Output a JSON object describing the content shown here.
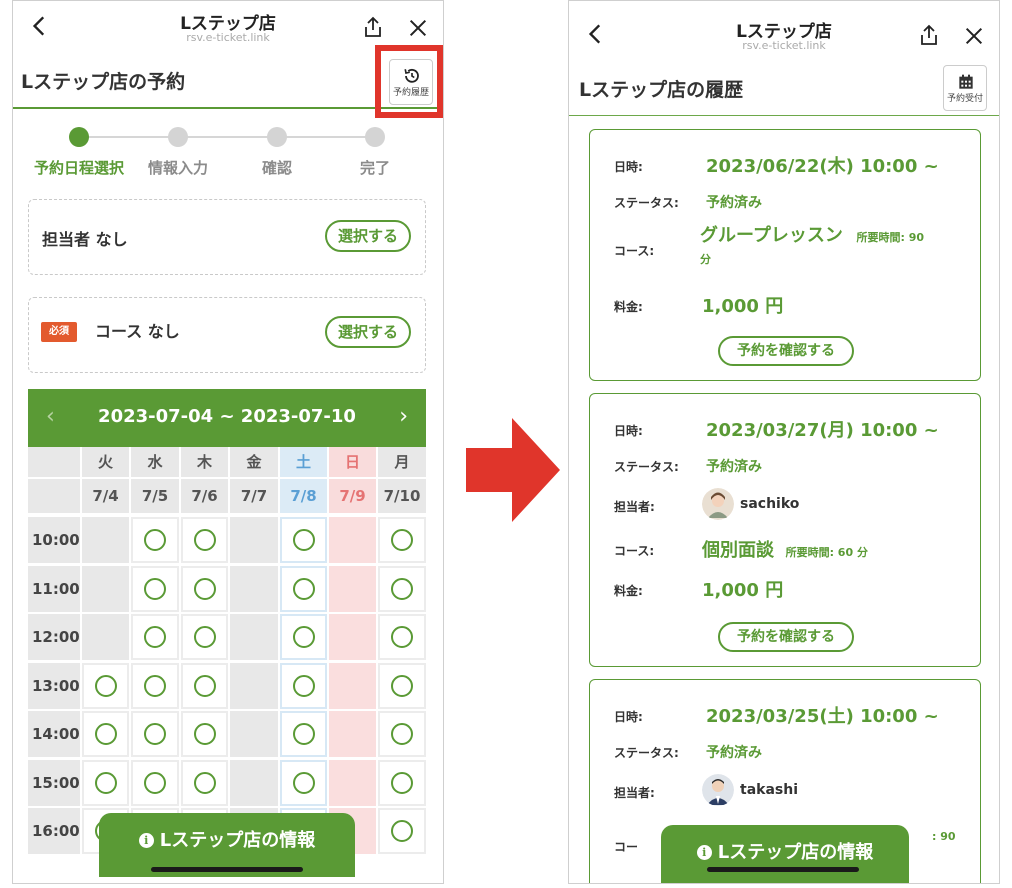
{
  "left": {
    "header": {
      "title": "Lステップ店",
      "url": "rsv.e-ticket.link"
    },
    "page_title": "Lステップ店の予約",
    "history_button": {
      "label": "予約履歴",
      "icon": "history-icon"
    },
    "steps": [
      {
        "label": "予約日程選択",
        "active": true
      },
      {
        "label": "情報入力",
        "active": false
      },
      {
        "label": "確認",
        "active": false
      },
      {
        "label": "完了",
        "active": false
      }
    ],
    "staff": {
      "text": "担当者 なし",
      "button": "選択する"
    },
    "course": {
      "badge": "必須",
      "text": "コース なし",
      "button": "選択する"
    },
    "calendar": {
      "range": "2023-07-04 ~ 2023-07-10",
      "prev": "‹",
      "next": "›",
      "days": [
        {
          "day": "火",
          "date": "7/4",
          "type": "weekday"
        },
        {
          "day": "水",
          "date": "7/5",
          "type": "weekday"
        },
        {
          "day": "木",
          "date": "7/6",
          "type": "weekday"
        },
        {
          "day": "金",
          "date": "7/7",
          "type": "weekday"
        },
        {
          "day": "土",
          "date": "7/8",
          "type": "sat"
        },
        {
          "day": "日",
          "date": "7/9",
          "type": "sun"
        },
        {
          "day": "月",
          "date": "7/10",
          "type": "weekday"
        }
      ],
      "times": [
        "10:00",
        "11:00",
        "12:00",
        "13:00",
        "14:00",
        "15:00",
        "16:00"
      ],
      "availability": [
        [
          0,
          1,
          1,
          0,
          1,
          0,
          1
        ],
        [
          0,
          1,
          1,
          0,
          1,
          0,
          1
        ],
        [
          0,
          1,
          1,
          0,
          1,
          0,
          1
        ],
        [
          1,
          1,
          1,
          0,
          1,
          0,
          1
        ],
        [
          1,
          1,
          1,
          0,
          1,
          0,
          1
        ],
        [
          1,
          1,
          1,
          0,
          1,
          0,
          1
        ],
        [
          1,
          1,
          1,
          0,
          1,
          0,
          1
        ]
      ]
    },
    "info_bar": "Lステップ店の情報"
  },
  "right": {
    "header": {
      "title": "Lステップ店",
      "url": "rsv.e-ticket.link"
    },
    "page_title": "Lステップ店の履歴",
    "reserve_button": {
      "label": "予約受付",
      "icon": "calendar-icon"
    },
    "labels": {
      "datetime": "日時:",
      "status": "ステータス:",
      "staff": "担当者:",
      "course": "コース:",
      "fee": "料金:"
    },
    "cards": [
      {
        "datetime": "2023/06/22(木) 10:00 ~",
        "status": "予約済み",
        "course": "グループレッスン",
        "duration": "所要時間: 90",
        "duration_unit": "分",
        "fee": "1,000 円",
        "button": "予約を確認する"
      },
      {
        "datetime": "2023/03/27(月) 10:00 ~",
        "status": "予約済み",
        "staff": "sachiko",
        "course": "個別面談",
        "duration": "所要時間: 60 分",
        "fee": "1,000 円",
        "button": "予約を確認する"
      },
      {
        "datetime": "2023/03/25(土) 10:00 ~",
        "status": "予約済み",
        "staff": "takashi",
        "course_label_partial": "コー",
        "duration_partial": ": 90"
      }
    ],
    "info_bar": "Lステップ店の情報"
  },
  "colors": {
    "green": "#5a9a35",
    "red": "#e0352b",
    "badge": "#e35a2e",
    "sat": "#dcebf6",
    "sun": "#f9dcdc"
  }
}
